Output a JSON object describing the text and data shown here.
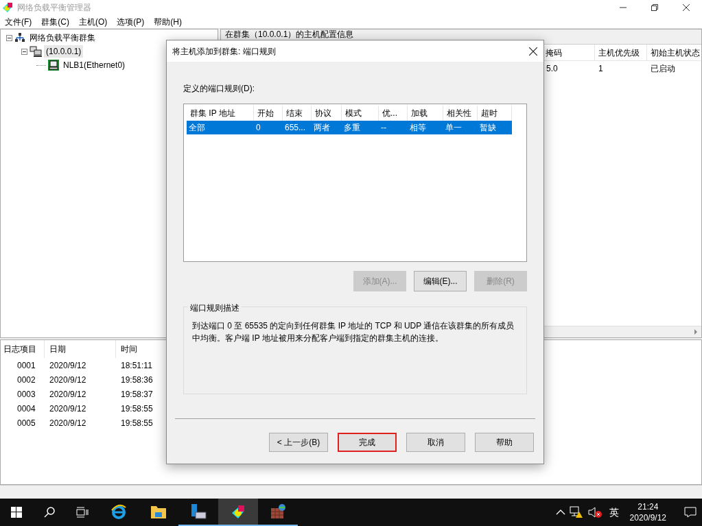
{
  "window": {
    "title": "网络负载平衡管理器"
  },
  "menu": [
    "文件(F)",
    "群集(C)",
    "主机(O)",
    "选项(P)",
    "帮助(H)"
  ],
  "tree": [
    {
      "label": "网络负载平衡群集",
      "kind": "root",
      "expanded": true,
      "selected": false,
      "children": [
        {
          "label": "(10.0.0.1)",
          "kind": "cluster",
          "expanded": true,
          "selected": true,
          "children": [
            {
              "label": "NLB1(Ethernet0)",
              "kind": "host",
              "selected": false
            }
          ]
        }
      ]
    }
  ],
  "host_config": {
    "title": "在群集（10.0.0.1）的主机配置信息",
    "columns": [
      "掩码",
      "主机优先级",
      "初始主机状态"
    ],
    "rows": [
      [
        "5.0",
        "1",
        "已启动"
      ]
    ]
  },
  "log": {
    "columns": [
      "日志项目",
      "日期",
      "时间"
    ],
    "rows": [
      [
        "0001",
        "2020/9/12",
        "18:51:11"
      ],
      [
        "0002",
        "2020/9/12",
        "19:58:36"
      ],
      [
        "0003",
        "2020/9/12",
        "19:58:37"
      ],
      [
        "0004",
        "2020/9/12",
        "19:58:55"
      ],
      [
        "0005",
        "2020/9/12",
        "19:58:55"
      ]
    ]
  },
  "dialog": {
    "title": "将主机添加到群集: 端口规则",
    "list_label": "定义的端口规则(D):",
    "columns": [
      "群集 IP 地址",
      "开始",
      "结束",
      "协议",
      "模式",
      "优...",
      "加载",
      "相关性",
      "超时"
    ],
    "rows": [
      {
        "cells": [
          "全部",
          "0",
          "655...",
          "两者",
          "多重",
          "--",
          "相等",
          "单一",
          "暂缺"
        ],
        "selected": true
      }
    ],
    "buttons": [
      {
        "label": "添加(A)...",
        "disabled": true
      },
      {
        "label": "编辑(E)...",
        "disabled": false
      },
      {
        "label": "删除(R)",
        "disabled": true
      }
    ],
    "description": {
      "title": "端口规则描述",
      "text": "到达端口 0 至 65535 的定向到任何群集 IP 地址的 TCP 和 UDP 通信在该群集的所有成员中均衡。客户端 IP 地址被用来分配客户端到指定的群集主机的连接。"
    },
    "nav_buttons": [
      {
        "label": "< 上一步(B)",
        "default": false
      },
      {
        "label": "完成",
        "default": true
      },
      {
        "label": "取消",
        "default": false
      },
      {
        "label": "帮助",
        "default": false
      }
    ]
  },
  "taskbar": {
    "apps": [
      {
        "kind": "ie",
        "active": false,
        "running": false
      },
      {
        "kind": "folder",
        "active": false,
        "running": false
      },
      {
        "kind": "server",
        "active": false,
        "running": true
      },
      {
        "kind": "nlb",
        "active": true,
        "running": true
      },
      {
        "kind": "box",
        "active": false,
        "running": true
      }
    ],
    "ime": "英",
    "time": "21:24",
    "date": "2020/9/12"
  }
}
